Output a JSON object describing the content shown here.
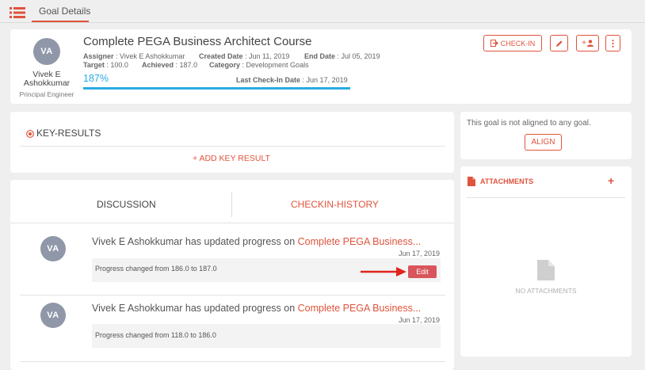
{
  "top_tab": {
    "label": "Goal Details"
  },
  "goal": {
    "avatar_initials": "VA",
    "owner_first": "Vivek E",
    "owner_last": "Ashokkumar",
    "owner_role": "Principal Engineer",
    "title": "Complete PEGA Business Architect Course",
    "assigner_label": "Assigner",
    "assigner_value": ": Vivek E Ashokkumar",
    "created_label": "Created Date",
    "created_value": ": Jun 11, 2019",
    "end_label": "End Date",
    "end_value": ": Jul 05, 2019",
    "target_label": "Target",
    "target_value": ": 100.0",
    "achieved_label": "Achieved",
    "achieved_value": ": 187.0",
    "category_label": "Category",
    "category_value": ": Development Goals",
    "progress_text": "187%",
    "progress_fraction": 1.0,
    "last_checkin_label": "Last Check-In Date",
    "last_checkin_value": ": Jun 17, 2019"
  },
  "actions": {
    "checkin_label": "CHECK-IN",
    "add_member_label": "+"
  },
  "key_results": {
    "title": "KEY-RESULTS",
    "add_label": "+ ADD KEY RESULT"
  },
  "tabs": {
    "discussion": "DISCUSSION",
    "checkin_history": "CHECKIN-HISTORY"
  },
  "feed": [
    {
      "initials": "VA",
      "text_prefix": "Vivek E Ashokkumar has updated progress on ",
      "text_link": "Complete PEGA Business...",
      "date": "Jun 17, 2019",
      "change": "Progress changed from 186.0 to 187.0",
      "edit_label": "Edit"
    },
    {
      "initials": "VA",
      "text_prefix": "Vivek E Ashokkumar has updated progress on ",
      "text_link": "Complete PEGA Business...",
      "date": "Jun 17, 2019",
      "change": "Progress changed from 118.0 to 186.0"
    }
  ],
  "alignment": {
    "text": "This goal is not aligned to any goal.",
    "align_label": "ALIGN"
  },
  "attachments": {
    "title": "ATTACHMENTS",
    "add_label": "+",
    "empty_text": "NO ATTACHMENTS"
  },
  "colors": {
    "accent": "#e0533c",
    "progress": "#29abe2",
    "avatar": "#8f97a8",
    "edit_button": "#d9555c"
  }
}
